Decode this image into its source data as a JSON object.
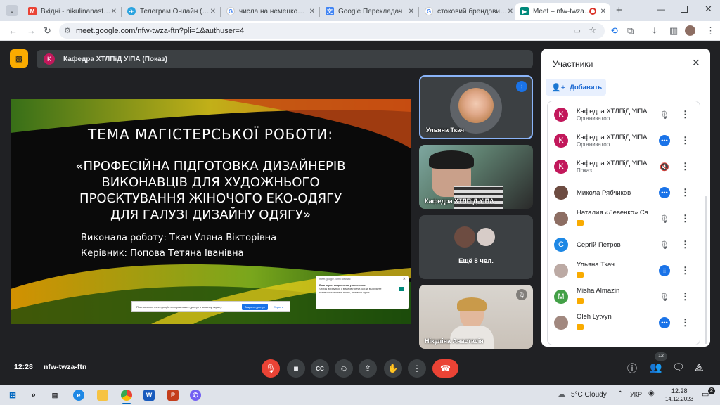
{
  "browser": {
    "tabs": [
      {
        "title": "Вхідні - nikulinanastya3@",
        "color": "#ea4335",
        "glyph": "M"
      },
      {
        "title": "Телеграм Онлайн (неоф",
        "color": "#2aa3df",
        "glyph": "✈"
      },
      {
        "title": "числа на немецком - По",
        "color": "#4285f4",
        "glyph": "G"
      },
      {
        "title": "Google Перекладач",
        "color": "#4285f4",
        "glyph": "文"
      },
      {
        "title": "стоковий брендовий од",
        "color": "#4285f4",
        "glyph": "G"
      },
      {
        "title": "Meet – nfw-twza-ftn",
        "color": "#00897b",
        "glyph": "▶"
      }
    ],
    "url": "meet.google.com/nfw-twza-ftn?pli=1&authuser=4",
    "new_tab": "+"
  },
  "meet": {
    "presenter_bar_label": "Кафедра ХТЛПіД УІПА (Показ)",
    "presenter_initial": "K",
    "slide": {
      "title": "ТЕМА МАГІСТЕРСЬКОЇ РОБОТИ:",
      "subtitle_lines": [
        "«ПРОФЕСІЙНА ПІДГОТОВКА ДИЗАЙНЕРІВ",
        "ВИКОНАВЦІВ ДЛЯ ХУДОЖНЬОГО",
        "ПРОЄКТУВАННЯ ЖІНОЧОГО ЕКО-ОДЯГУ",
        "ДЛЯ ГАЛУЗІ ДИЗАЙНУ ОДЯГУ»"
      ],
      "author": "Виконала роботу: Ткач Уляна Вікторівна",
      "supervisor": "Керівник: Попова Тетяна Іванівна",
      "share_notice": "Приложению meet.google.com разрешен доступ к вашему экрану.",
      "share_stop_btn": "Закрыть доступ",
      "share_hide_link": "Скрыть",
      "popup_site": "meet.google.com • сейчас",
      "popup_title": "Ваш экран виден всем участникам",
      "popup_body": "Чтобы вернуться к видеовстрече, когда вы будете готовы остановить показ, нажмите здесь."
    },
    "tiles": [
      {
        "name": "Ульяна Ткач"
      },
      {
        "name": "Кафедра ХТЛПіД УІПА"
      },
      {
        "name": "Ещё 8 чел."
      },
      {
        "name": "Нікуліна Анастасія"
      }
    ],
    "time": "12:28",
    "meeting_code": "nfw-twza-ftn",
    "participants_count": "12"
  },
  "panel": {
    "title": "Участники",
    "add_label": "Добавить",
    "participants": [
      {
        "initial": "K",
        "name": "Кафедра ХТЛПіД УІПА",
        "role": "Организатор",
        "color": "#c2185b",
        "status": "muted"
      },
      {
        "initial": "K",
        "name": "Кафедра ХТЛПіД УІПА",
        "role": "Организатор",
        "color": "#c2185b",
        "status": "speaking"
      },
      {
        "initial": "K",
        "name": "Кафедра ХТЛПіД УІПА",
        "role": "Показ",
        "color": "#c2185b",
        "status": "muted"
      },
      {
        "initial": "",
        "name": "Микола Рябчиков",
        "role": "",
        "color": "#6d4c41",
        "status": "speaking"
      },
      {
        "initial": "",
        "name": "Наталия «Левенко» Са...",
        "role": "",
        "color": "#8d6e63",
        "status": "muted"
      },
      {
        "initial": "С",
        "name": "Сергій Петров",
        "role": "",
        "color": "#1e88e5",
        "status": "muted"
      },
      {
        "initial": "",
        "name": "Ульяна Ткач",
        "role": "",
        "color": "#bcaaa4",
        "status": "active"
      },
      {
        "initial": "M",
        "name": "Misha Almazin",
        "role": "",
        "color": "#43a047",
        "status": "muted"
      },
      {
        "initial": "",
        "name": "Oleh Lytvyn",
        "role": "",
        "color": "#a1887f",
        "status": "speaking"
      }
    ]
  },
  "taskbar": {
    "weather": "5°C  Cloudy",
    "lang": "УКР",
    "time": "12:28",
    "date": "14.12.2023",
    "notif_count": "2"
  }
}
